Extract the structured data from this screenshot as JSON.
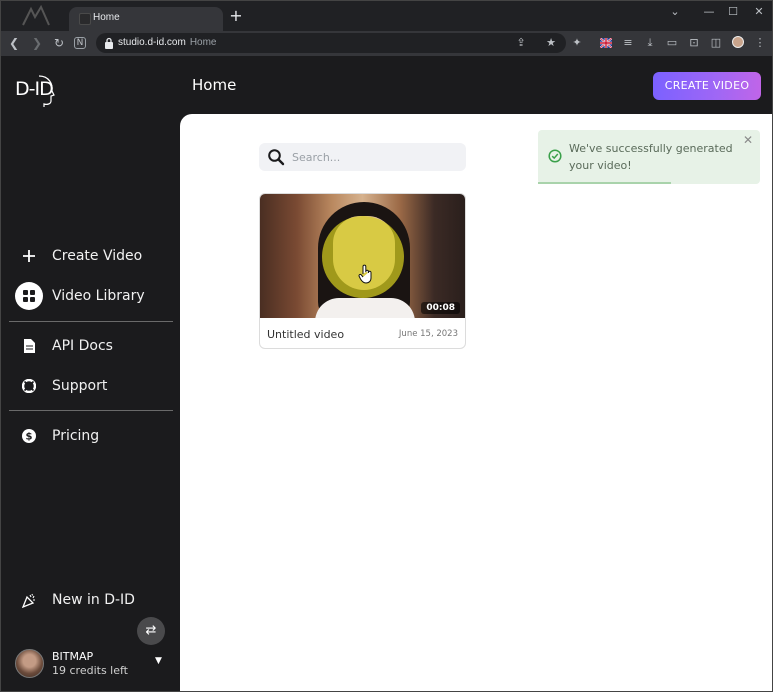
{
  "browser": {
    "tab_title": "Home",
    "new_tab_symbol": "+",
    "url_domain": "studio.d-id.com",
    "url_page": "Home"
  },
  "app": {
    "brand": "D-ID",
    "page_title": "Home",
    "create_button": "CREATE VIDEO",
    "accent_gradient": [
      "#7b61ff",
      "#c065e8"
    ]
  },
  "sidebar": {
    "items": [
      {
        "label": "Create Video",
        "icon": "plus-icon"
      },
      {
        "label": "Video Library",
        "icon": "grid-icon",
        "active": true
      },
      {
        "label": "API Docs",
        "icon": "document-icon"
      },
      {
        "label": "Support",
        "icon": "lifebuoy-icon"
      },
      {
        "label": "Pricing",
        "icon": "dollar-icon"
      },
      {
        "label": "New in D-ID",
        "icon": "party-popper-icon"
      }
    ],
    "user": {
      "name": "BITMAP",
      "credits": "19 credits left"
    }
  },
  "search": {
    "placeholder": "Search..."
  },
  "videos": [
    {
      "title": "Untitled video",
      "date": "June 15, 2023",
      "duration": "00:08"
    }
  ],
  "toast": {
    "message": "We've successfully generated your video!",
    "status_color": "#3aa04a",
    "progress": 0.6
  }
}
